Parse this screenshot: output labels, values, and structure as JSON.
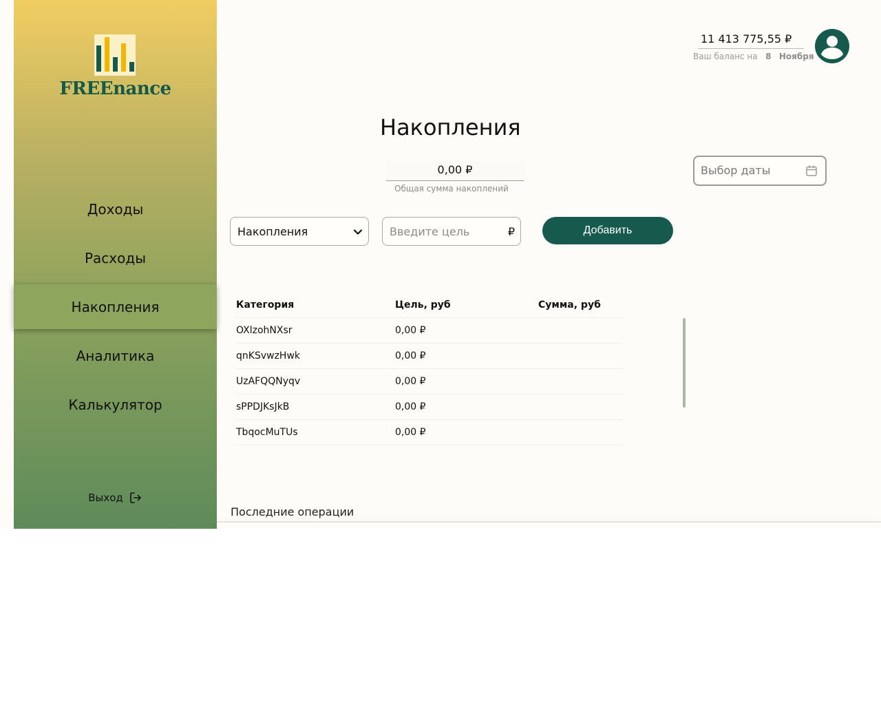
{
  "brand": {
    "name": "FREEnance",
    "colors": {
      "primary": "#155a4d",
      "logo_yellow": "#f2b600"
    }
  },
  "sidebar": {
    "items": [
      {
        "label": "Доходы"
      },
      {
        "label": "Расходы"
      },
      {
        "label": "Накопления",
        "active": true
      },
      {
        "label": "Аналитика"
      },
      {
        "label": "Калькулятор"
      }
    ],
    "logout_label": "Выход"
  },
  "header": {
    "balance": "11 413 775,55 ₽",
    "balance_caption": "Ваш баланс на",
    "balance_day": "8",
    "balance_month": "Ноября"
  },
  "main": {
    "title": "Накопления",
    "total_value": "0,00 ₽",
    "total_caption": "Общая сумма накоплений",
    "date_picker_placeholder": "Выбор даты",
    "category_select_value": "Накопления",
    "goal_placeholder": "Введите цель",
    "goal_currency": "₽",
    "add_button": "Добавить",
    "table": {
      "headers": [
        "Категория",
        "Цель, руб",
        "Сумма, руб"
      ],
      "rows": [
        {
          "category": "OXlzohNXsr",
          "goal": "0,00 ₽",
          "sum": ""
        },
        {
          "category": "qnKSvwzHwk",
          "goal": "0,00 ₽",
          "sum": ""
        },
        {
          "category": "UzAFQQNyqv",
          "goal": "0,00 ₽",
          "sum": ""
        },
        {
          "category": "sPPDJKsJkB",
          "goal": "0,00 ₽",
          "sum": ""
        },
        {
          "category": "TbqocMuTUs",
          "goal": "0,00 ₽",
          "sum": ""
        }
      ]
    },
    "recent_title": "Последние операции"
  }
}
